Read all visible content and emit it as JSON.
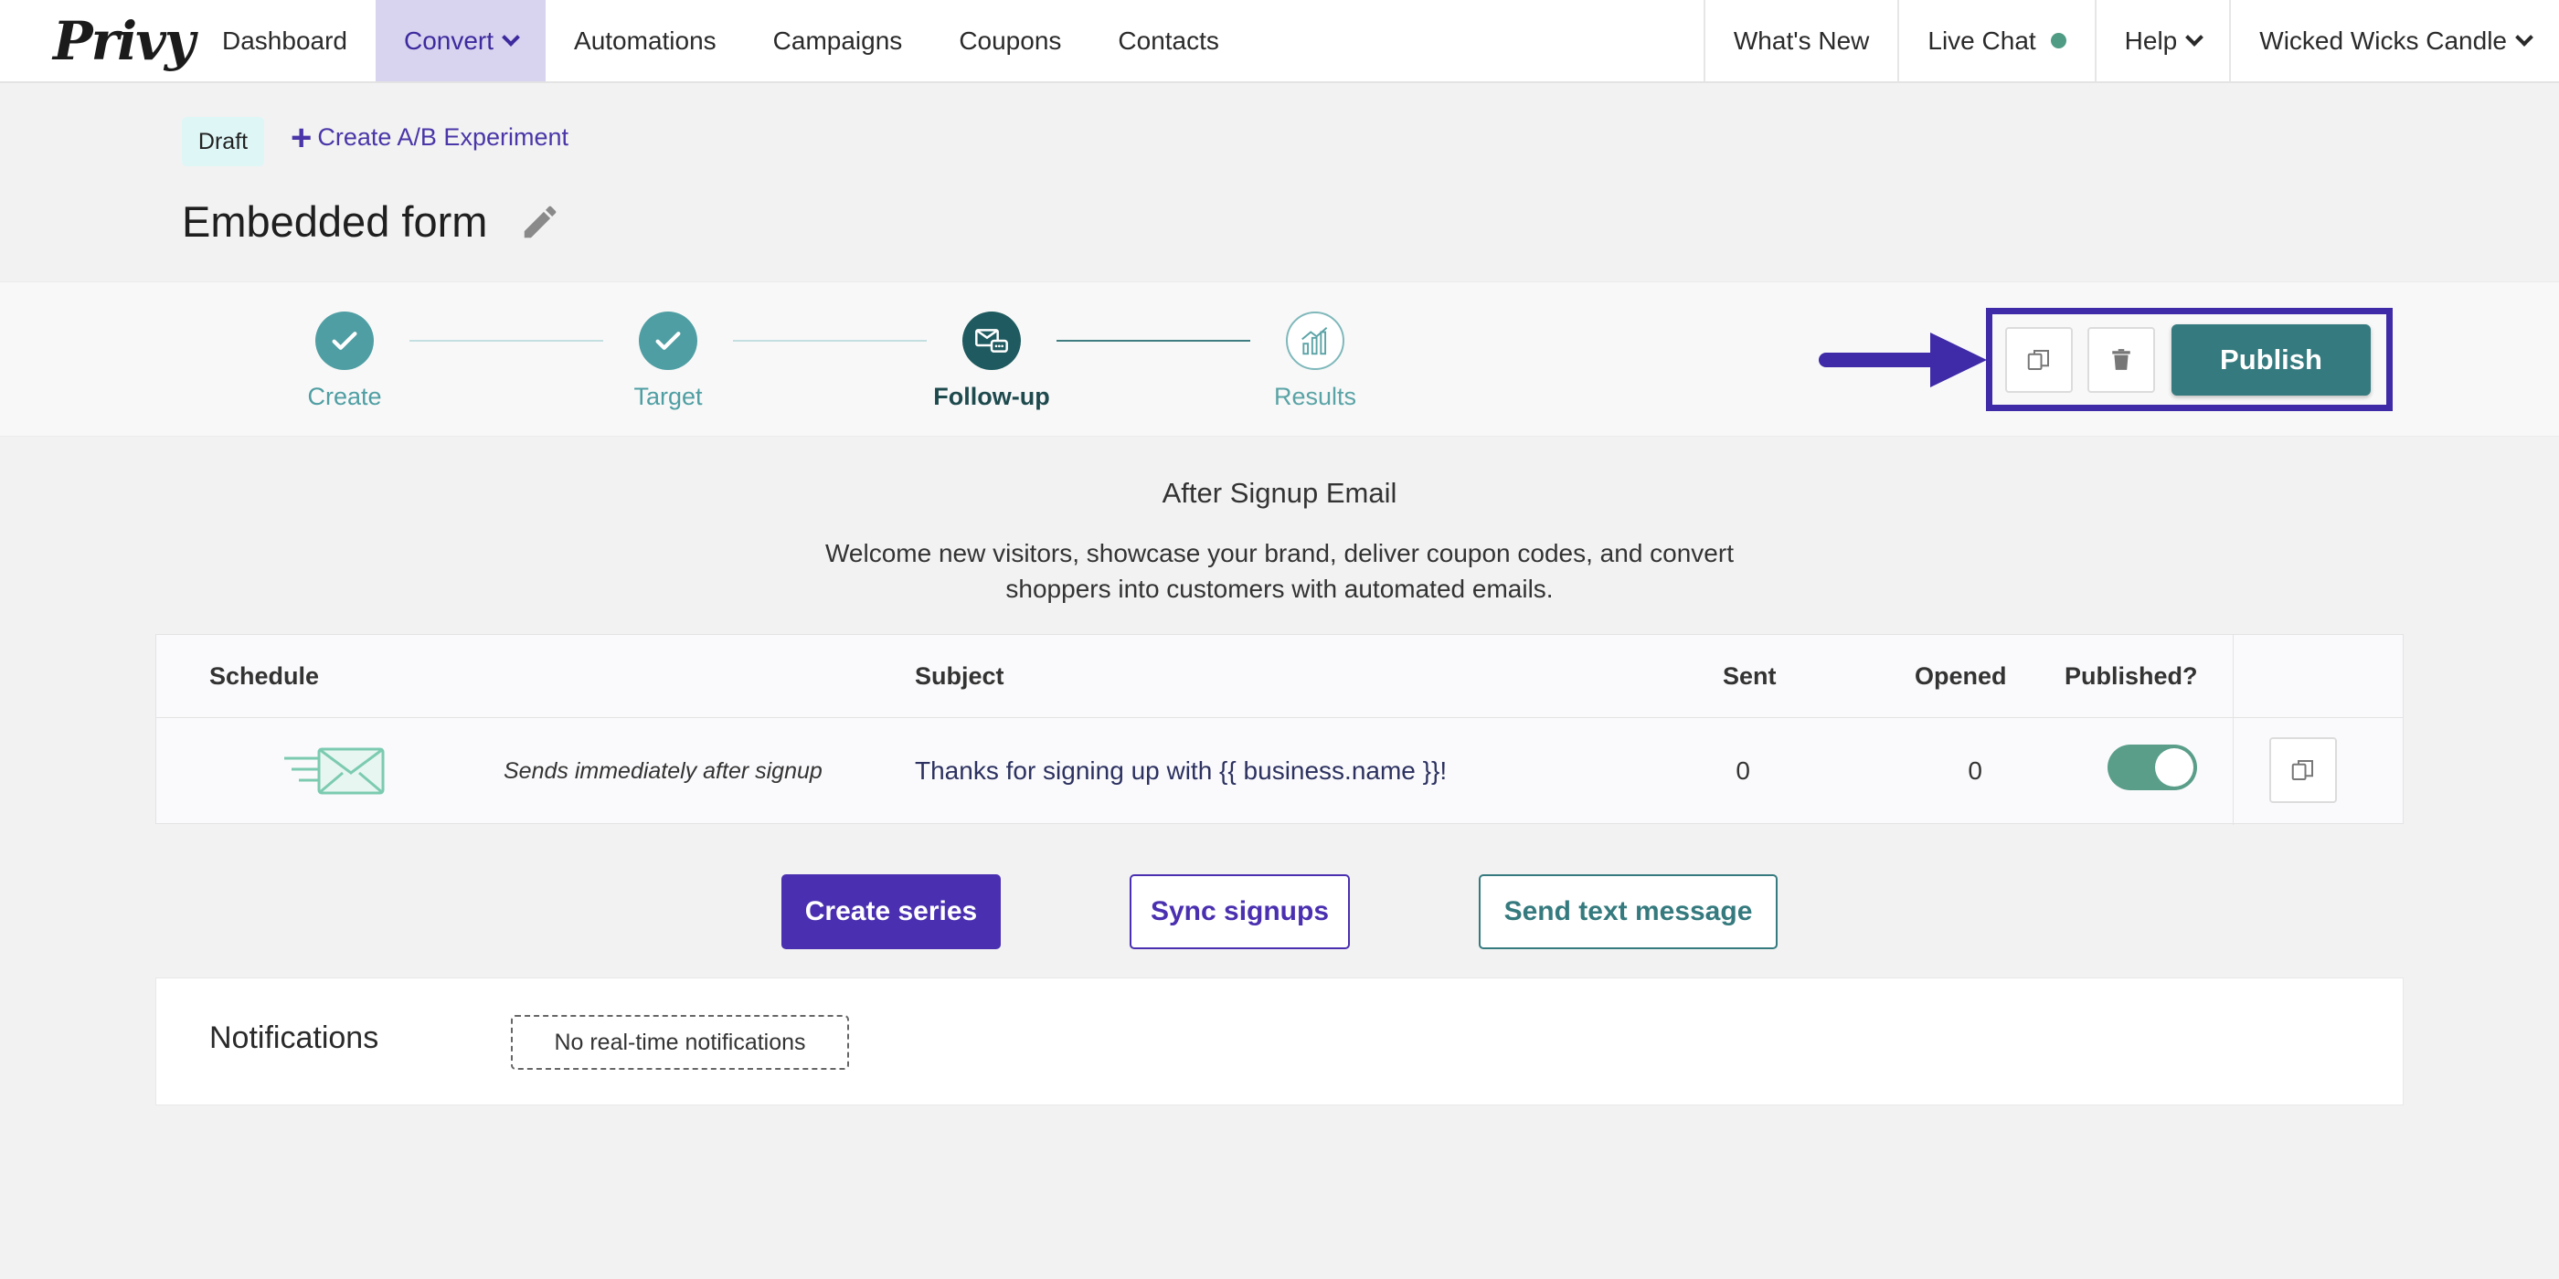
{
  "nav": {
    "logo": "Privy",
    "items": [
      {
        "label": "Dashboard",
        "active": false,
        "dropdown": false
      },
      {
        "label": "Convert",
        "active": true,
        "dropdown": true
      },
      {
        "label": "Automations",
        "active": false,
        "dropdown": false
      },
      {
        "label": "Campaigns",
        "active": false,
        "dropdown": false
      },
      {
        "label": "Coupons",
        "active": false,
        "dropdown": false
      },
      {
        "label": "Contacts",
        "active": false,
        "dropdown": false
      }
    ],
    "right": {
      "whats_new": "What's New",
      "live_chat": "Live Chat",
      "help": "Help",
      "account": "Wicked Wicks Candle"
    }
  },
  "header": {
    "status_badge": "Draft",
    "ab_link": "Create A/B Experiment",
    "title": "Embedded form"
  },
  "steps": [
    {
      "label": "Create",
      "state": "done"
    },
    {
      "label": "Target",
      "state": "done"
    },
    {
      "label": "Follow-up",
      "state": "current"
    },
    {
      "label": "Results",
      "state": "future"
    }
  ],
  "actions": {
    "publish_label": "Publish",
    "duplicate_icon": "duplicate-icon",
    "delete_icon": "trash-icon"
  },
  "email_section": {
    "title": "After Signup Email",
    "description": "Welcome new visitors, showcase your brand, deliver coupon codes, and convert shoppers into customers with automated emails."
  },
  "table": {
    "headers": {
      "schedule": "Schedule",
      "subject": "Subject",
      "sent": "Sent",
      "opened": "Opened",
      "published": "Published?"
    },
    "rows": [
      {
        "schedule": "Sends immediately after signup",
        "subject": "Thanks for signing up with {{ business.name }}!",
        "sent": "0",
        "opened": "0",
        "published": true
      }
    ]
  },
  "buttons": {
    "create_series": "Create series",
    "sync_signups": "Sync signups",
    "send_text": "Send text message"
  },
  "notifications": {
    "title": "Notifications",
    "empty": "No real-time notifications"
  },
  "colors": {
    "brand_purple": "#4a30b0",
    "teal": "#357a7e",
    "nav_active_bg": "#d8d3ee",
    "live_dot": "#4f9b84"
  }
}
